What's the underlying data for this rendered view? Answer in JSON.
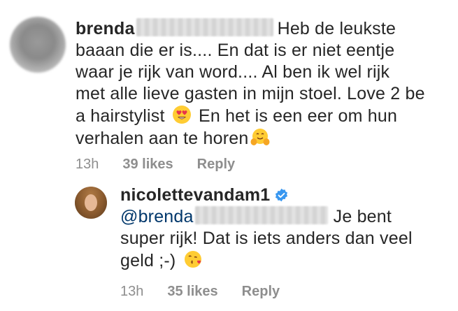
{
  "comment": {
    "username": "brenda",
    "text_lines": [
      "Heb de leukste",
      "baaan die er is.... En dat is er niet eentje",
      "waar je rijk van word.... Al ben ik wel rijk",
      "met alle lieve gasten in mijn stoel. Love 2 be",
      "a hairstylist",
      "En het is een eer om hun",
      "verhalen aan te horen"
    ],
    "time": "13h",
    "likes": "39 likes",
    "reply_label": "Reply"
  },
  "reply": {
    "username": "nicolettevandam1",
    "mention": "@brenda",
    "text_lines": [
      "Je bent",
      "super rijk! Dat is iets anders dan veel",
      "geld ;-)"
    ],
    "time": "13h",
    "likes": "35 likes",
    "reply_label": "Reply"
  },
  "icons": {
    "verified": "verified-badge-icon",
    "emoji_heart_eyes": "heart-eyes-emoji-icon",
    "emoji_hug": "hugging-face-emoji-icon",
    "emoji_kiss": "kissing-heart-emoji-icon"
  },
  "colors": {
    "text": "#262626",
    "meta": "#8e8e8e",
    "mention": "#00376b",
    "verified": "#3897f0"
  }
}
